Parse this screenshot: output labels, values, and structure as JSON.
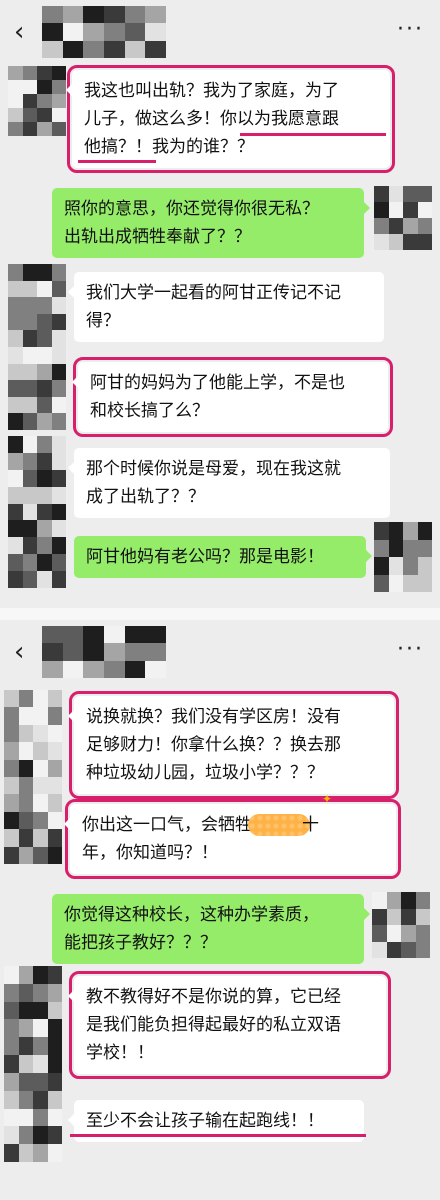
{
  "top": {
    "back_icon": "‹",
    "more_icon": "···",
    "messages": [
      {
        "dir": "in",
        "lines": [
          "我这也叫出轨？我为了家庭，为了",
          "儿子，做这么多！你以为我愿意跟",
          "他搞？！我为的谁？？"
        ]
      },
      {
        "dir": "out",
        "lines": [
          "照你的意思，你还觉得你很无私？",
          "出轨出成牺牲奉献了？？"
        ]
      },
      {
        "dir": "in",
        "lines": [
          "我们大学一起看的阿甘正传记不记",
          "得？"
        ]
      },
      {
        "dir": "in",
        "lines": [
          "阿甘的妈妈为了他能上学，不是也",
          "和校长搞了么？"
        ]
      },
      {
        "dir": "in",
        "lines": [
          "那个时候你说是母爱，现在我这就",
          "成了出轨了？？"
        ]
      },
      {
        "dir": "out",
        "lines": [
          "阿甘他妈有老公吗？那是电影！"
        ]
      }
    ]
  },
  "bottom": {
    "back_icon": "‹",
    "more_icon": "···",
    "messages": [
      {
        "dir": "in",
        "lines": [
          "说换就换？我们没有学区房！没有",
          "足够财力！你拿什么换？？换去那",
          "种垃圾幼儿园，垃圾小学？？？"
        ]
      },
      {
        "dir": "in",
        "lines": [
          "你出这一口气，会牺牲",
          "十",
          "年，你知道吗？！"
        ]
      },
      {
        "dir": "out",
        "lines": [
          "你觉得这种校长，这种办学素质，",
          "能把孩子教好？？？"
        ]
      },
      {
        "dir": "in",
        "lines": [
          "教不教得好不是你说的算，它已经",
          "是我们能负担得起最好的私立双语",
          "学校！！"
        ]
      },
      {
        "dir": "in",
        "lines": [
          "至少不会让孩子输在起跑线！！"
        ]
      }
    ]
  },
  "colors": {
    "bg": "#ededed",
    "incoming": "#ffffff",
    "outgoing": "#95ec69",
    "highlight": "#d81f6c",
    "censor": "#ffb347"
  }
}
